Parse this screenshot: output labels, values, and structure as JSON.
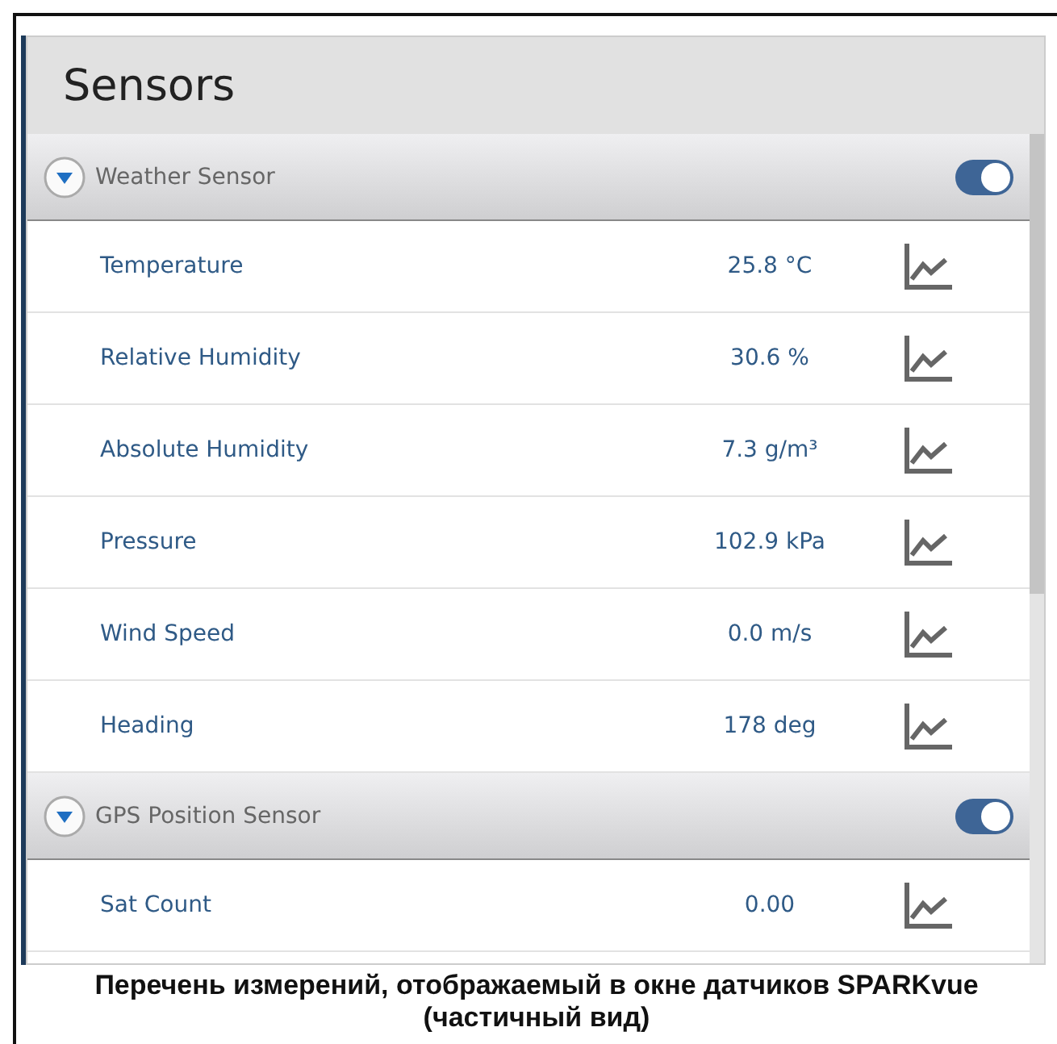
{
  "window": {
    "title": "Sensors"
  },
  "groups": [
    {
      "name": "Weather Sensor",
      "expanded": true,
      "on": true,
      "measurements": [
        {
          "name": "Temperature",
          "value": "25.8 °C"
        },
        {
          "name": "Relative Humidity",
          "value": "30.6 %"
        },
        {
          "name": "Absolute Humidity",
          "value": "7.3 g/m³"
        },
        {
          "name": "Pressure",
          "value": "102.9 kPa"
        },
        {
          "name": "Wind Speed",
          "value": "0.0 m/s"
        },
        {
          "name": "Heading",
          "value": "178 deg"
        }
      ]
    },
    {
      "name": "GPS Position Sensor",
      "expanded": true,
      "on": true,
      "measurements": [
        {
          "name": "Sat Count",
          "value": "0.00"
        }
      ]
    }
  ],
  "caption": [
    "Перечень измерений, отображаемый в окне датчиков SPARKvue",
    "(частичный вид)"
  ]
}
